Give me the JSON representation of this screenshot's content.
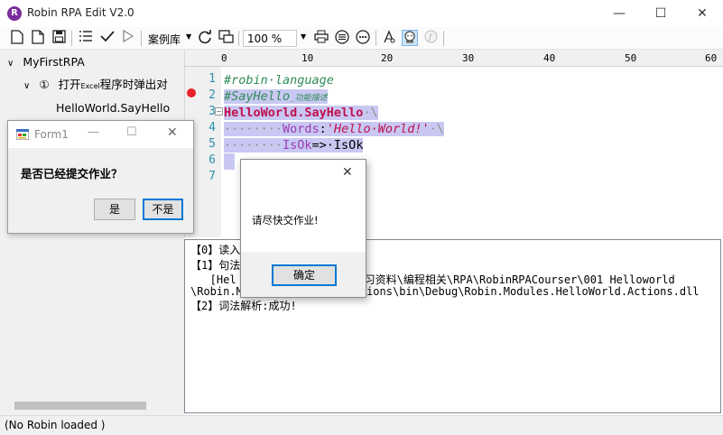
{
  "window": {
    "title": "Robin RPA Edit V2.0",
    "icon_letter": "R"
  },
  "toolbar": {
    "example_lib_label": "案例库",
    "zoom_value": "100 %"
  },
  "tree": {
    "root": "MyFirstRPA",
    "step_number": "①",
    "step_text_pre": "打开",
    "step_text_small": "Excel",
    "step_text_post": "程序时弹出对",
    "child": "HelloWorld.SayHello"
  },
  "editor": {
    "ruler_ticks": [
      "0",
      "10",
      "20",
      "30",
      "40",
      "50",
      "60"
    ],
    "line_numbers": [
      "1",
      "2",
      "3",
      "4",
      "5",
      "6",
      "7"
    ],
    "code": {
      "l1": "#robin·language",
      "l2_main": "#SayHello",
      "l2_note": "_功能描述",
      "l3_kw": "HelloWorld.SayHello",
      "l3_rest": "·\\",
      "l4_dots": "········",
      "l4_param": "Words",
      "l4_colon": ":",
      "l4_str": "'Hello·World!'",
      "l4_rest": "·\\",
      "l5_dots": "········",
      "l5_param": "IsOk",
      "l5_arrow": "=>·IsOk"
    }
  },
  "output": {
    "lines": [
      "【0】读入",
      "【1】句法",
      "   [Hel                  学习资料\\编程相关\\RPA\\RobinRPACourser\\001 Helloworld",
      "\\Robin.M                 ctions\\bin\\Debug\\Robin.Modules.HelloWorld.Actions.dll",
      "【2】词法解析:成功!"
    ]
  },
  "status": {
    "text": "(No Robin loaded )"
  },
  "form1": {
    "title": "Form1",
    "message": "是否已经提交作业？",
    "yes_label": "是",
    "no_label": "不是"
  },
  "msgbox": {
    "message": "请尽快交作业!",
    "ok_label": "确定"
  }
}
